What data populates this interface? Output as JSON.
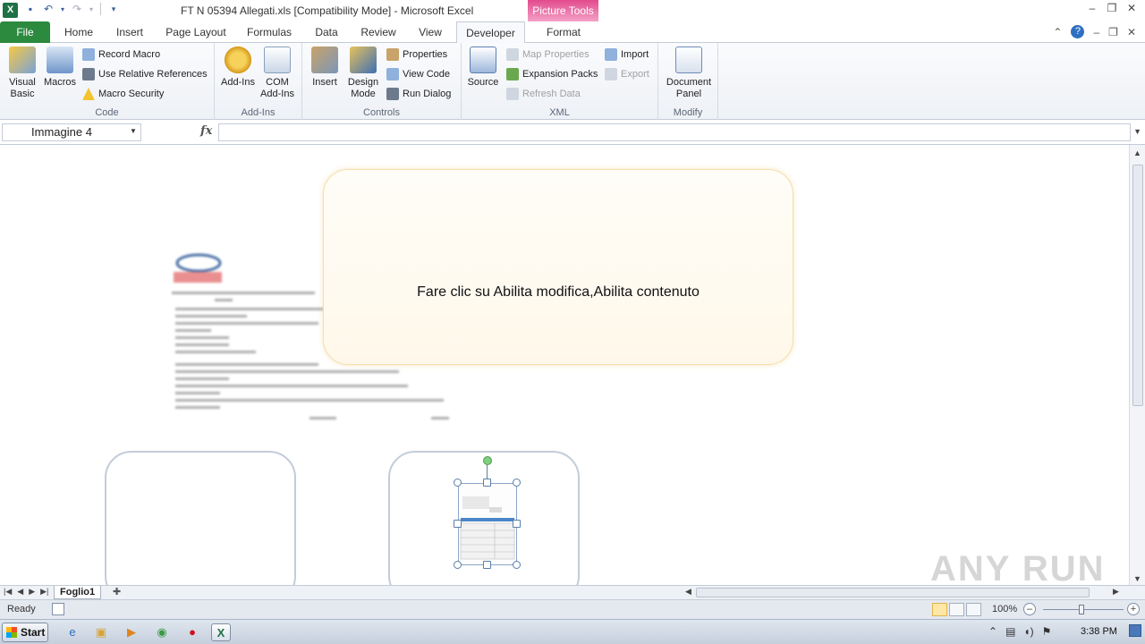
{
  "titlebar": {
    "title": "FT N 05394 Allegati.xls  [Compatibility Mode]  -  Microsoft Excel",
    "context_tab_group": "Picture Tools",
    "app_icon": "X"
  },
  "ribbon_tabs": [
    "File",
    "Home",
    "Insert",
    "Page Layout",
    "Formulas",
    "Data",
    "Review",
    "View",
    "Developer",
    "Format"
  ],
  "active_tab": "Developer",
  "ribbon": {
    "code": {
      "label": "Code",
      "visual_basic": "Visual Basic",
      "macros": "Macros",
      "record_macro": "Record Macro",
      "use_relative_references": "Use Relative References",
      "macro_security": "Macro Security"
    },
    "addins": {
      "label": "Add-Ins",
      "addins": "Add-Ins",
      "com_addins": "COM Add-Ins"
    },
    "controls": {
      "label": "Controls",
      "insert": "Insert",
      "design_mode": "Design Mode",
      "properties": "Properties",
      "view_code": "View Code",
      "run_dialog": "Run Dialog"
    },
    "xml": {
      "label": "XML",
      "source": "Source",
      "map_properties": "Map Properties",
      "expansion_packs": "Expansion Packs",
      "refresh_data": "Refresh Data",
      "import": "Import",
      "export": "Export"
    },
    "modify": {
      "label": "Modify",
      "document_panel": "Document Panel"
    }
  },
  "formula_bar": {
    "name_box": "Immagine 4",
    "fx": "fx",
    "value": ""
  },
  "sheet": {
    "notice_text": "Fare clic su Abilita modifica,Abilita contenuto",
    "watermark": "ANY RUN"
  },
  "sheet_tabs": [
    "Foglio1"
  ],
  "status": {
    "ready": "Ready",
    "zoom": "100%"
  },
  "taskbar": {
    "start": "Start",
    "clock": "3:38 PM"
  },
  "colors": {
    "file_tab": "#2b8a3e",
    "picture_tools": "#e24b8e",
    "notice_border": "#f5deaa"
  }
}
